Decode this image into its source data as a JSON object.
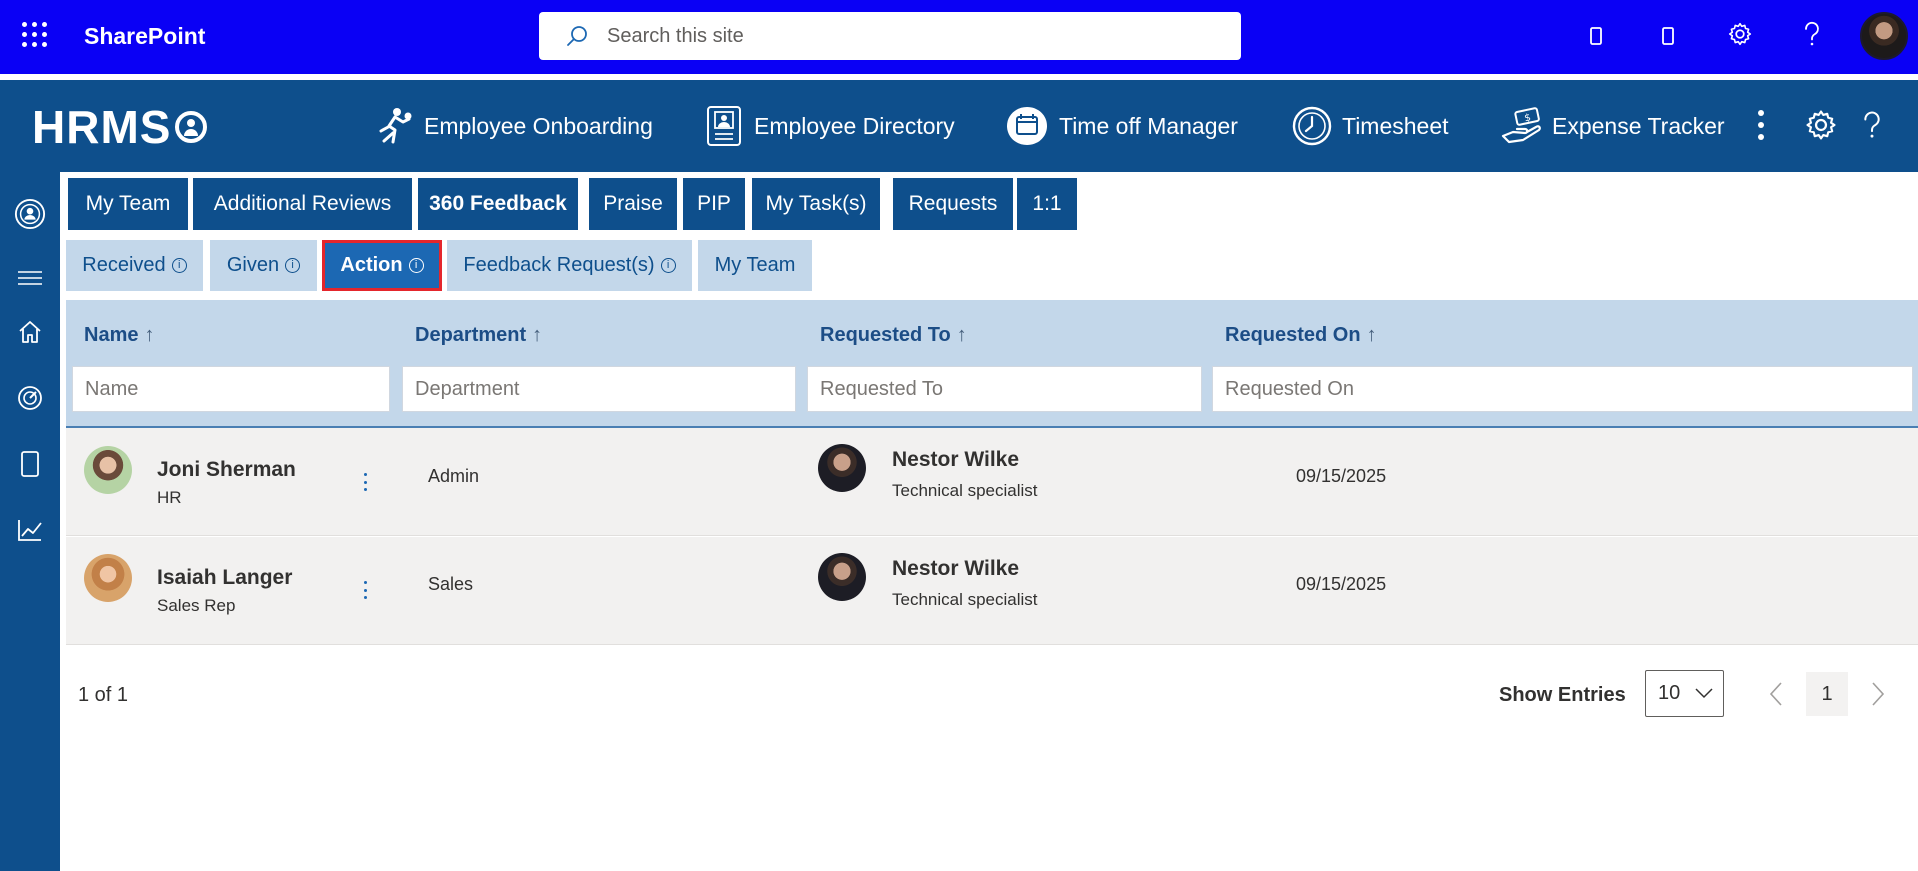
{
  "suite": {
    "app_name": "SharePoint",
    "search_placeholder": "Search this site",
    "bar_color": "#0a00f5"
  },
  "app": {
    "logo": "HRMS",
    "brand_color": "#0e4f8c",
    "nav": [
      {
        "label": "Employee Onboarding",
        "icon": "onboarding-icon"
      },
      {
        "label": "Employee Directory",
        "icon": "directory-icon"
      },
      {
        "label": "Time off Manager",
        "icon": "calendar-icon"
      },
      {
        "label": "Timesheet",
        "icon": "clock-icon"
      },
      {
        "label": "Expense Tracker",
        "icon": "expense-icon"
      }
    ]
  },
  "tabs_primary": [
    "My Team",
    "Additional Reviews",
    "360 Feedback",
    "Praise",
    "PIP",
    "My Task(s)",
    "Requests",
    "1:1"
  ],
  "tabs_secondary": [
    {
      "label": "Received",
      "info": "i"
    },
    {
      "label": "Given",
      "info": "i"
    },
    {
      "label": "Action",
      "info": "i"
    },
    {
      "label": "Feedback Request(s)",
      "info": "i"
    },
    {
      "label": "My Team"
    }
  ],
  "active_secondary_tab": "Action",
  "grid": {
    "columns": [
      {
        "label": "Name",
        "sort": "↑",
        "filter_placeholder": "Name"
      },
      {
        "label": "Department",
        "sort": "↑",
        "filter_placeholder": "Department"
      },
      {
        "label": "Requested To",
        "sort": "↑",
        "filter_placeholder": "Requested To"
      },
      {
        "label": "Requested On",
        "sort": "↑",
        "filter_placeholder": "Requested On"
      }
    ],
    "rows": [
      {
        "name": "Joni Sherman",
        "title": "HR",
        "department": "Admin",
        "requested_to": "Nestor Wilke",
        "requested_to_title": "Technical specialist",
        "requested_on": "09/15/2025"
      },
      {
        "name": "Isaiah Langer",
        "title": "Sales Rep",
        "department": "Sales",
        "requested_to": "Nestor Wilke",
        "requested_to_title": "Technical specialist",
        "requested_on": "09/15/2025"
      }
    ]
  },
  "footer": {
    "page_info": "1 of 1",
    "show_entries_label": "Show Entries",
    "entries_value": "10",
    "current_page": "1"
  }
}
